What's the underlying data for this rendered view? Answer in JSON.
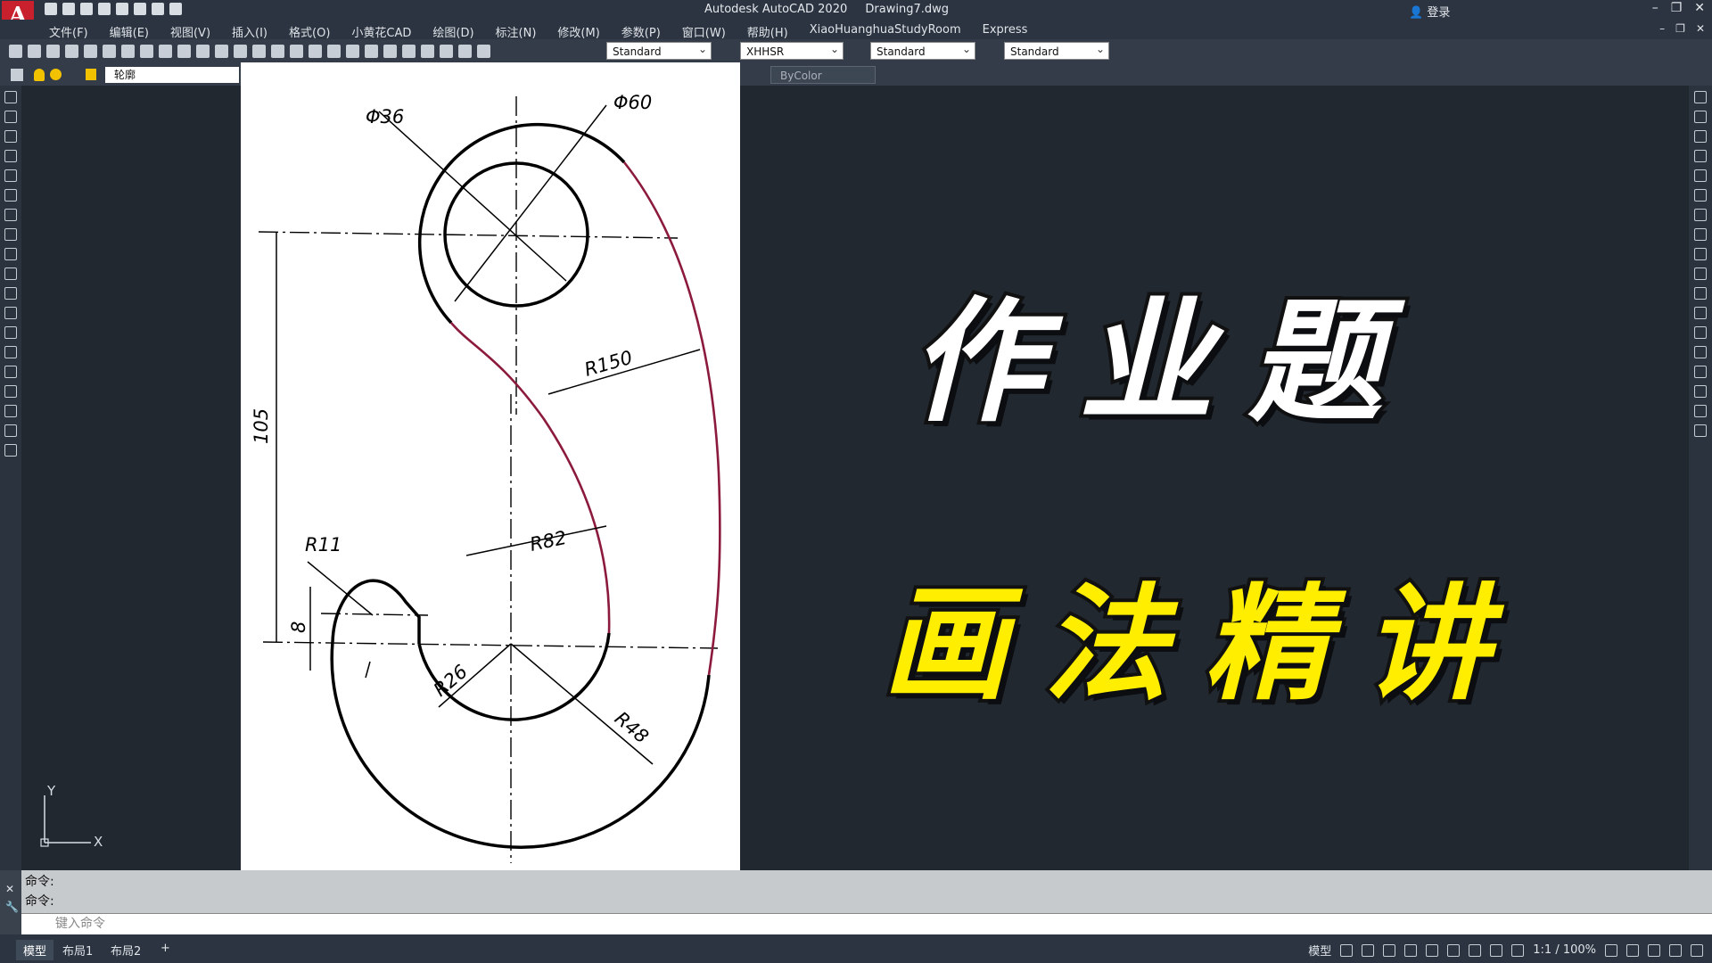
{
  "titlebar": {
    "app_name": "Autodesk AutoCAD 2020",
    "file_name": "Drawing7.dwg",
    "login": "登录"
  },
  "menu": [
    "文件(F)",
    "编辑(E)",
    "视图(V)",
    "插入(I)",
    "格式(O)",
    "小黄花CAD",
    "绘图(D)",
    "标注(N)",
    "修改(M)",
    "参数(P)",
    "窗口(W)",
    "帮助(H)",
    "XiaoHuanghuaStudyRoom",
    "Express"
  ],
  "styles": {
    "text_style": "Standard",
    "dim_style": "XHHSR",
    "table_style": "Standard",
    "mleader_style": "Standard"
  },
  "layer": {
    "name": "轮廓",
    "color": "ByColor"
  },
  "drawing": {
    "d36": "Φ36",
    "d60": "Φ60",
    "r150": "R150",
    "d105": "105",
    "r82": "R82",
    "r11": "R11",
    "d8": "8",
    "r26": "R26",
    "r48": "R48"
  },
  "overlay": {
    "line1": "作业题",
    "line2": "画法精讲"
  },
  "ucs": {
    "y": "Y",
    "x": "X"
  },
  "command": {
    "history": [
      "命令:",
      "命令:"
    ],
    "placeholder": "键入命令"
  },
  "status": {
    "tabs": [
      "模型",
      "布局1",
      "布局2"
    ],
    "add_tab": "+",
    "model_label": "模型",
    "scale": "1:1 / 100%"
  },
  "colors": {
    "accent_title": "#ffee00",
    "curve": "#8b1a3c"
  }
}
